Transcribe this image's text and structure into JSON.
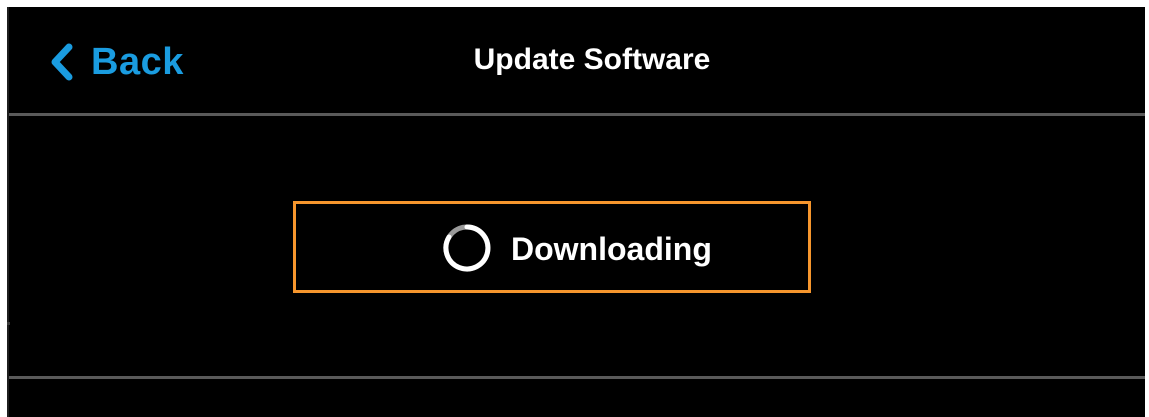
{
  "header": {
    "back_label": "Back",
    "back_icon": "chevron-left-icon",
    "title": "Update Software"
  },
  "status": {
    "label": "Downloading",
    "icon": "spinner-icon"
  },
  "colors": {
    "background": "#000000",
    "accent": "#1a9ce0",
    "highlight_border": "#f6962d",
    "divider": "#5a5a5a",
    "text": "#ffffff"
  }
}
